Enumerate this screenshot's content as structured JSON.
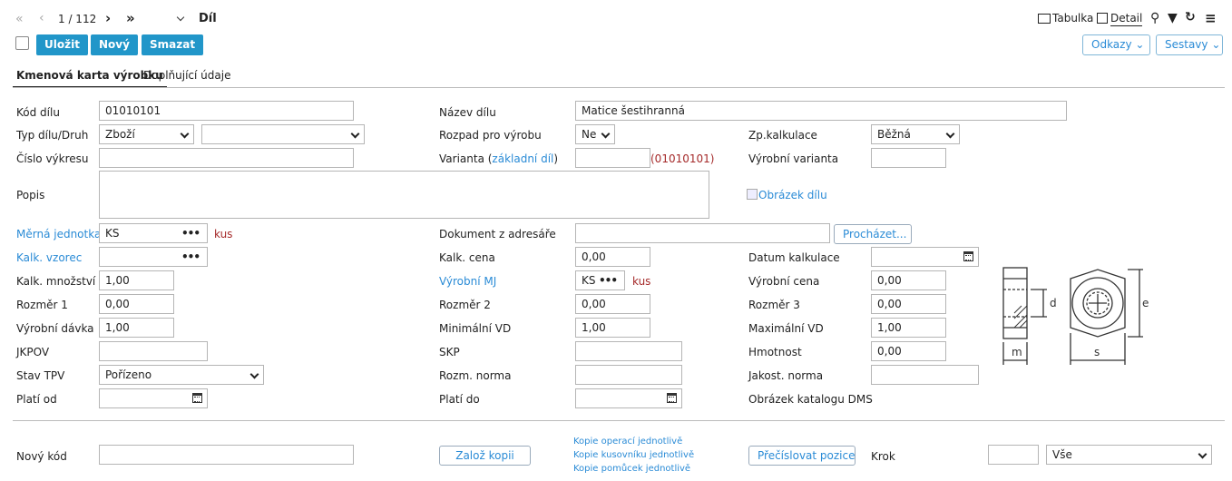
{
  "nav": {
    "pager": "1 / 112",
    "title": "Díl"
  },
  "toolbar": {
    "save": "Uložit",
    "new": "Nový",
    "delete": "Smazat"
  },
  "top_right": {
    "table": "Tabulka",
    "detail": "Detail",
    "links": "Odkazy",
    "reports": "Sestavy"
  },
  "tabs": [
    "Kmenová karta výrobku",
    "Doplňující údaje"
  ],
  "labels": {
    "kod": "Kód dílu",
    "typ": "Typ dílu/Druh",
    "cislo": "Číslo výkresu",
    "popis": "Popis",
    "mj": "Měrná jednotka",
    "vzorec": "Kalk. vzorec",
    "mnozstvi": "Kalk. množství",
    "rozmer1": "Rozměr 1",
    "davka": "Výrobní dávka",
    "jkpov": "JKPOV",
    "stav": "Stav TPV",
    "plati_od": "Platí od",
    "nazev": "Název dílu",
    "rozpad": "Rozpad pro výrobu",
    "varianta_pre": "Varianta (",
    "varianta_link": "základní díl",
    "varianta_post": ")",
    "dokument": "Dokument z adresáře",
    "kalk_cena": "Kalk. cena",
    "vyrobni_mj": "Výrobní MJ",
    "rozmer2": "Rozměr 2",
    "min_vd": "Minimální VD",
    "skp": "SKP",
    "rozm_norma": "Rozm. norma",
    "plati_do": "Platí do",
    "zp_kalk": "Zp.kalkulace",
    "vyr_varianta": "Výrobní varianta",
    "obrazek": "Obrázek dílu",
    "datum_kalk": "Datum kalkulace",
    "vyr_cena": "Výrobní cena",
    "rozmer3": "Rozměr 3",
    "max_vd": "Maximální VD",
    "hmotnost": "Hmotnost",
    "jakost": "Jakost. norma",
    "katalog": "Obrázek katalogu DMS",
    "novy_kod": "Nový kód",
    "krok": "Krok"
  },
  "values": {
    "kod": "01010101",
    "typ": "Zboží",
    "druh": "",
    "cislo": "",
    "popis": "",
    "mj": "KS",
    "mj_unit": "kus",
    "vzorec": "",
    "mnozstvi": "1,00",
    "rozmer1": "0,00",
    "davka": "1,00",
    "jkpov": "",
    "stav": "Pořízeno",
    "plati_od": "",
    "nazev": "Matice šestihranná",
    "rozpad": "Ne",
    "varianta": "",
    "varianta_ref": "(01010101)",
    "dokument": "",
    "kalk_cena": "0,00",
    "vyrobni_mj": "KS",
    "vyrobni_mj_unit": "kus",
    "rozmer2": "0,00",
    "min_vd": "1,00",
    "skp": "",
    "rozm_norma": "",
    "plati_do": "",
    "zp_kalk": "Běžná",
    "vyr_varianta": "",
    "datum_kalk": "",
    "vyr_cena": "0,00",
    "rozmer3": "0,00",
    "max_vd": "1,00",
    "hmotnost": "0,00",
    "jakost": "",
    "novy_kod": "",
    "krok": "",
    "filter": "Vše"
  },
  "buttons": {
    "browse": "Procházet...",
    "copy": "Založ kopii",
    "renumber": "Přečíslovat pozice"
  },
  "copy_links": [
    "Kopie operací jednotlivě",
    "Kopie kusovníku jednotlivě",
    "Kopie pomůcek jednotlivě"
  ],
  "drawing": {
    "dim_d": "d",
    "dim_e": "e",
    "dim_m": "m",
    "dim_s": "s"
  }
}
